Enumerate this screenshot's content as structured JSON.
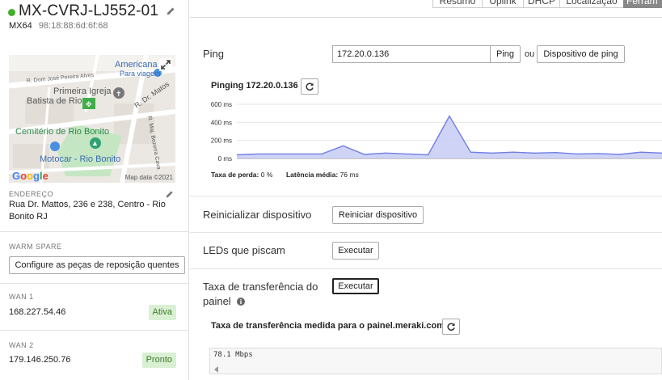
{
  "device": {
    "name": "MX-CVRJ-LJ552-01",
    "model": "MX64",
    "mac": "98:18:88:6d:6f:68",
    "status_color": "#43b02a"
  },
  "map": {
    "labels": {
      "americana": "Americana",
      "para_viagem": "Para viagem",
      "street1": "R. Dom José Pereira Alves",
      "primeira_igreja_1": "Primeira Igreja",
      "primeira_igreja_2": "Batista de Rio",
      "street2": "R. Dr. Matos",
      "street3": "R. Maj. Bezerra Cava",
      "cemiterio": "Cemitério de Rio Bonito",
      "motocar": "Motocar - Rio Bonito",
      "copyright": "Map data ©2021",
      "google": [
        "G",
        "o",
        "o",
        "g",
        "l",
        "e"
      ]
    }
  },
  "address": {
    "label": "ENDEREÇO",
    "value": "Rua Dr. Mattos, 236 e 238, Centro - Rio Bonito RJ"
  },
  "warm_spare": {
    "label": "WARM SPARE",
    "button": "Configure as peças de reposição quentes"
  },
  "wan1": {
    "label": "WAN 1",
    "ip": "168.227.54.46",
    "status": "Ativa"
  },
  "wan2": {
    "label": "WAN 2",
    "ip": "179.146.250.76",
    "status": "Pronto"
  },
  "tabs": [
    "Resumo",
    "Uplink",
    "DHCP",
    "Localização",
    "Ferram"
  ],
  "ping": {
    "label": "Ping",
    "input_value": "172.20.0.136",
    "button": "Ping",
    "or_text": "ou",
    "device_button": "Dispositivo de ping",
    "result_title": "Pinging 172.20.0.136",
    "loss_label": "Taxa de perda:",
    "loss_value": "0 %",
    "latency_label": "Latência média:",
    "latency_value": "76 ms"
  },
  "chart_data": {
    "type": "area",
    "y_ticks": [
      "600 ms",
      "400 ms",
      "200 ms",
      "0 ms"
    ],
    "ylim": [
      0,
      600
    ],
    "y_unit": "ms",
    "grid": true,
    "series": [
      {
        "values": [
          40,
          50,
          50,
          50,
          50,
          140,
          45,
          60,
          50,
          40,
          470,
          70,
          60,
          70,
          60,
          65,
          50,
          55,
          45,
          70,
          60
        ]
      }
    ],
    "fill_color": "#c7cdf5",
    "line_color": "#6f7de6"
  },
  "reboot": {
    "label": "Reinicializar dispositivo",
    "button": "Reiniciar dispositivo"
  },
  "leds": {
    "label": "LEDs que piscam",
    "button": "Executar"
  },
  "throughput": {
    "label": "Taxa de transferência do painel",
    "button": "Executar",
    "measure_title": "Taxa de transferência medida para o painel.meraki.com",
    "output": "78.1 Mbps"
  }
}
